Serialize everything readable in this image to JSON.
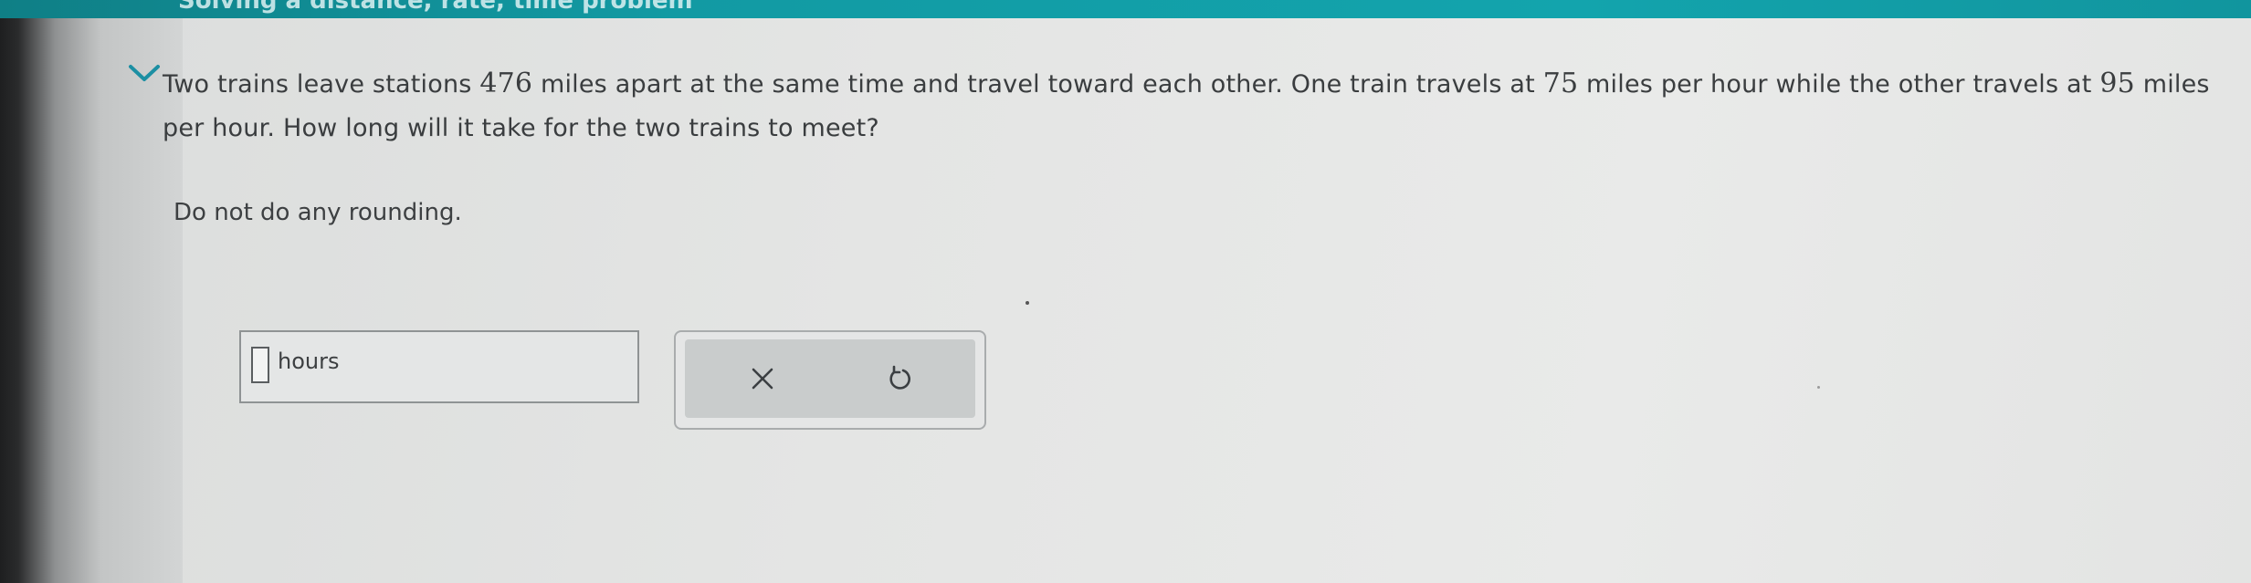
{
  "header": {
    "title": "Solving a distance, rate, time problem"
  },
  "question": {
    "part1": "Two trains leave stations ",
    "distance": "476",
    "part2": " miles apart at the same time and travel toward each other. One train travels at ",
    "speed1": "75",
    "part3": " miles per hour while the other travels at ",
    "speed2": "95",
    "part4": " miles per hour. How long will it take for the two trains to meet?"
  },
  "instruction": "Do not do any rounding.",
  "answer": {
    "value": "",
    "unit": "hours"
  },
  "tools": {
    "clear_icon": "x-icon",
    "undo_icon": "undo-icon"
  },
  "colors": {
    "accent": "#13a4ad",
    "text": "#3a3d3f"
  }
}
